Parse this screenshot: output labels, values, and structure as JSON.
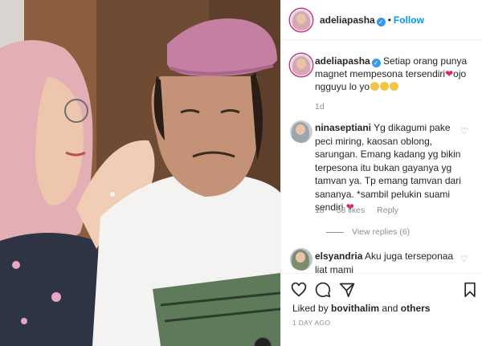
{
  "post": {
    "author": "adeliapasha",
    "follow_label": "Follow",
    "caption_user": "adeliapasha",
    "caption_text": "Setiap orang punya magnet mempesona tersendiri",
    "caption_after": "ojo ngguyu lo yo",
    "caption_time": "1d"
  },
  "comments": [
    {
      "user": "ninaseptiani",
      "text": "Yg dikagumi pake peci miring, kaosan oblong, sarungan. Emang kadang yg bikin terpesona itu bukan gayanya yg tamvan ya. Tp emang tamvan dari sananya. *sambil pelukin suami sendiri",
      "time": "1d",
      "likes": "38 likes",
      "reply": "Reply",
      "view_replies": "View replies (6)"
    },
    {
      "user": "elsyandria",
      "text": "Aku juga terseponaa liat mami"
    }
  ],
  "actions": {
    "liked_by_prefix": "Liked by",
    "liked_by_user": "bovithalim",
    "liked_by_and": "and",
    "liked_by_others": "others",
    "date": "1 DAY AGO"
  },
  "icons": [
    "heart-icon",
    "comment-icon",
    "share-icon",
    "bookmark-icon",
    "verified-icon"
  ],
  "colors": {
    "link": "#0095f6",
    "verified": "#3897f0",
    "heart": "#e0245e",
    "muted": "#8e8e8e"
  }
}
